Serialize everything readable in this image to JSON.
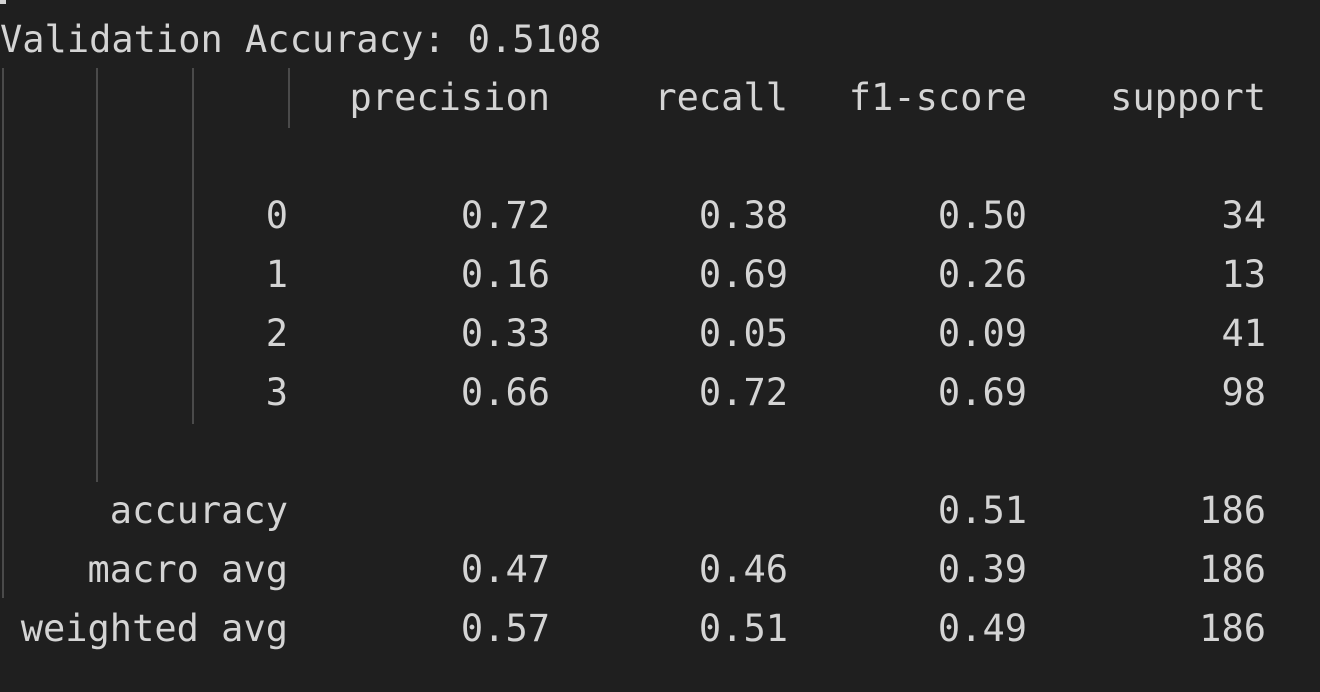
{
  "terminal": {
    "header_line": "Validation Accuracy: 0.5108",
    "report": {
      "columns": [
        "precision",
        "recall",
        "f1-score",
        "support"
      ],
      "class_rows": [
        {
          "label": "0",
          "precision": "0.72",
          "recall": "0.38",
          "f1": "0.50",
          "support": "34"
        },
        {
          "label": "1",
          "precision": "0.16",
          "recall": "0.69",
          "f1": "0.26",
          "support": "13"
        },
        {
          "label": "2",
          "precision": "0.33",
          "recall": "0.05",
          "f1": "0.09",
          "support": "41"
        },
        {
          "label": "3",
          "precision": "0.66",
          "recall": "0.72",
          "f1": "0.69",
          "support": "98"
        }
      ],
      "accuracy_row": {
        "label": "accuracy",
        "f1": "0.51",
        "support": "186"
      },
      "avg_rows": [
        {
          "label": "macro avg",
          "precision": "0.47",
          "recall": "0.46",
          "f1": "0.39",
          "support": "186"
        },
        {
          "label": "weighted avg",
          "precision": "0.57",
          "recall": "0.51",
          "f1": "0.49",
          "support": "186"
        }
      ]
    }
  },
  "colors": {
    "background": "#1f1f1f",
    "text": "#d4d4d4",
    "indent_guide": "#4a4a4a"
  }
}
